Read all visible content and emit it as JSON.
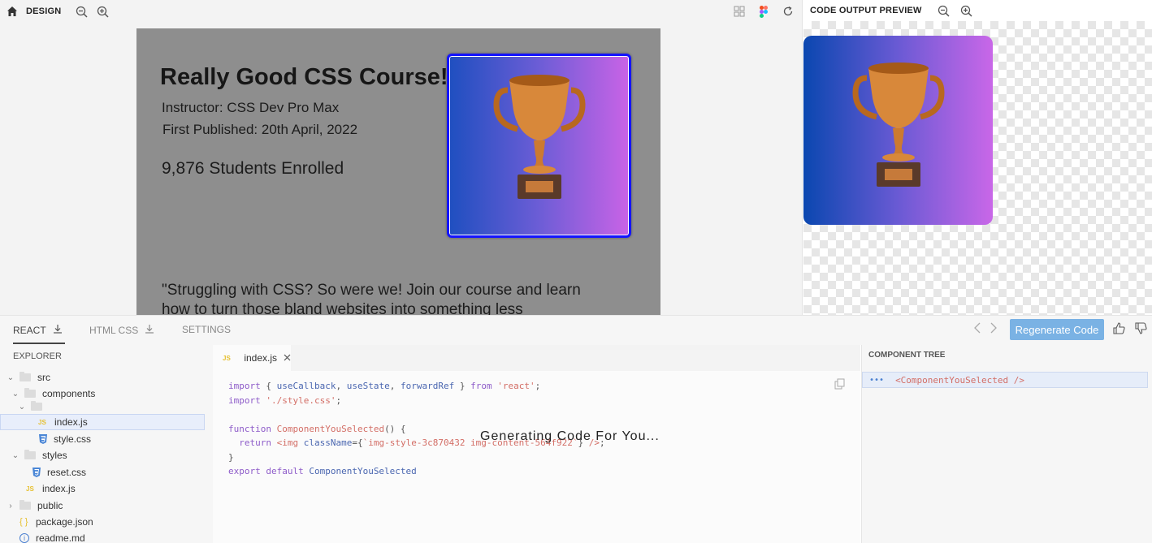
{
  "design_toolbar": {
    "label": "DESIGN"
  },
  "design_frame": {
    "title": "Really Good CSS Course!",
    "instructor": "Instructor: CSS Dev Pro Max",
    "published": "First Published: 20th April, 2022",
    "enrolled": "9,876 Students Enrolled",
    "quote": "\"Struggling with CSS? So were we! Join our course and learn how to turn those bland websites into something less"
  },
  "preview": {
    "label": "CODE OUTPUT PREVIEW"
  },
  "tabs": {
    "react": "REACT",
    "html_css": "HTML CSS",
    "settings": "SETTINGS"
  },
  "actions": {
    "regenerate": "Regenerate Code"
  },
  "explorer": {
    "title": "EXPLORER",
    "items": [
      {
        "label": "src"
      },
      {
        "label": "components"
      },
      {
        "label": ""
      },
      {
        "label": "index.js"
      },
      {
        "label": "style.css"
      },
      {
        "label": "styles"
      },
      {
        "label": "reset.css"
      },
      {
        "label": "index.js"
      },
      {
        "label": "public"
      },
      {
        "label": "package.json"
      },
      {
        "label": "readme.md"
      }
    ]
  },
  "editor": {
    "tab": "index.js",
    "lines": [
      "import { useCallback, useState, forwardRef } from 'react';",
      "import './style.css';",
      "",
      "function ComponentYouSelected() {",
      "  return <img className={`img-style-3c870432 img-content-564f922`} />;",
      "}",
      "export default ComponentYouSelected"
    ],
    "status": "Generating Code For You..."
  },
  "component_tree": {
    "title": "COMPONENT TREE",
    "node": "<ComponentYouSelected />"
  }
}
